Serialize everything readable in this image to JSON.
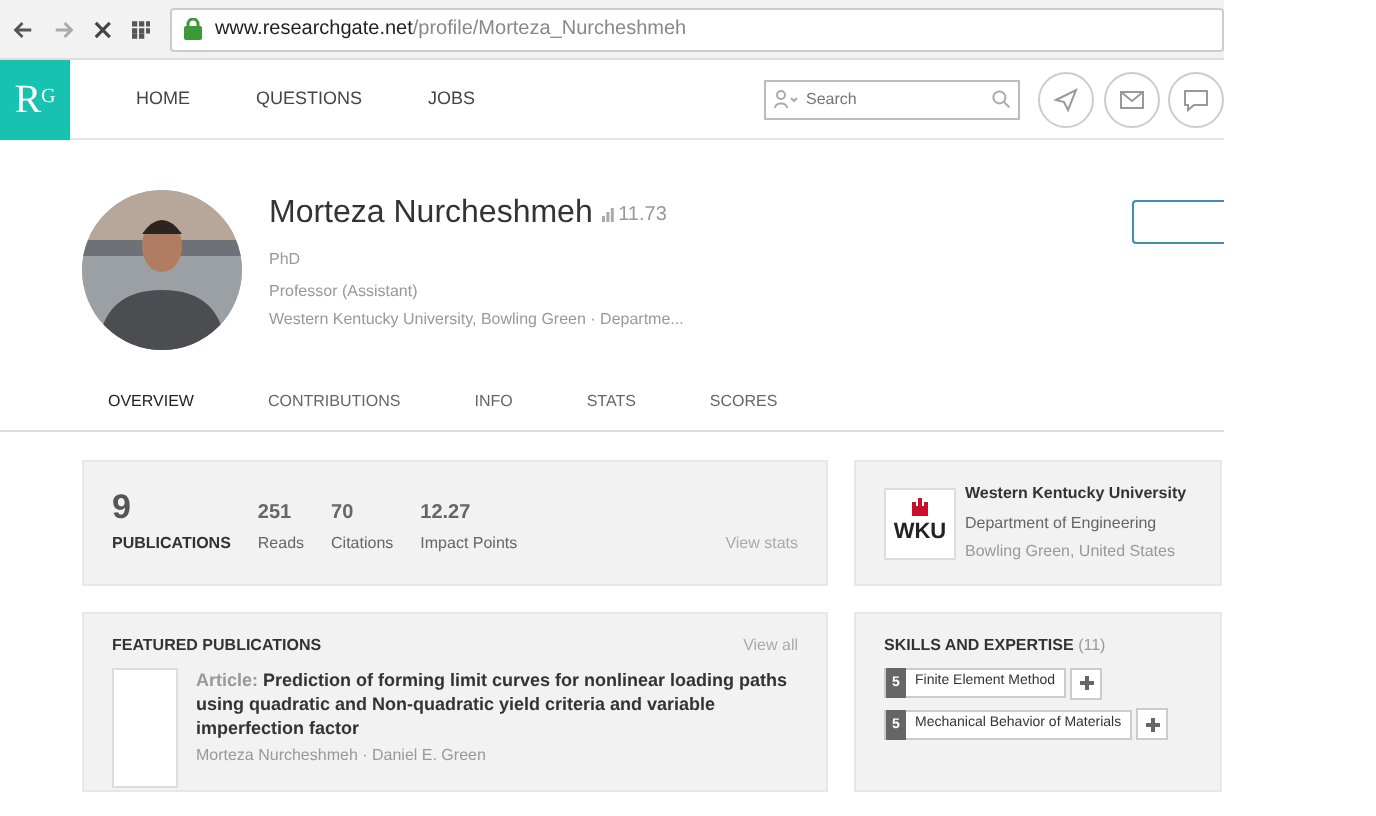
{
  "browser": {
    "url_host": "www.researchgate.net",
    "url_path": "/profile/Morteza_Nurcheshmeh"
  },
  "nav": {
    "logo": "R$^{G}$",
    "items": [
      {
        "label": "HOME"
      },
      {
        "label": "QUESTIONS"
      },
      {
        "label": "JOBS"
      }
    ],
    "search": {
      "placeholder": "Search"
    }
  },
  "profile": {
    "name": "Morteza Nurcheshmeh",
    "score": "11.73",
    "degree": "PhD",
    "position": "Professor (Assistant)",
    "affiliation": "Western Kentucky University, Bowling Green · Departme..."
  },
  "tabs": [
    {
      "label": "OVERVIEW",
      "selected": true
    },
    {
      "label": "CONTRIBUTIONS",
      "selected": false
    },
    {
      "label": "INFO",
      "selected": false
    },
    {
      "label": "STATS",
      "selected": false
    },
    {
      "label": "SCORES",
      "selected": false
    }
  ],
  "stats": {
    "count": "9",
    "label": "PUBLICATIONS",
    "metrics": [
      {
        "value": "251",
        "label": "Reads"
      },
      {
        "value": "70",
        "label": "Citations"
      },
      {
        "value": "12.27",
        "label": "Impact Points"
      }
    ],
    "link": "View stats"
  },
  "institution": {
    "logo": "WKU",
    "name": "Western Kentucky University",
    "department": "Department of Engineering",
    "location": "Bowling Green, United States"
  },
  "featured": {
    "title": "FEATURED PUBLICATIONS",
    "link": "View all",
    "publication": {
      "type": "Article:",
      "title": "Prediction of forming limit curves for nonlinear loading paths using quadratic and Non-quadratic yield criteria and variable imperfection factor",
      "authors": "Morteza Nurcheshmeh · Daniel E. Green"
    }
  },
  "skills": {
    "title": "SKILLS AND EXPERTISE",
    "count": "(11)",
    "items": [
      {
        "endorsements": "5",
        "name": "Finite Element Method"
      },
      {
        "endorsements": "5",
        "name": "Mechanical Behavior of Materials"
      }
    ]
  }
}
